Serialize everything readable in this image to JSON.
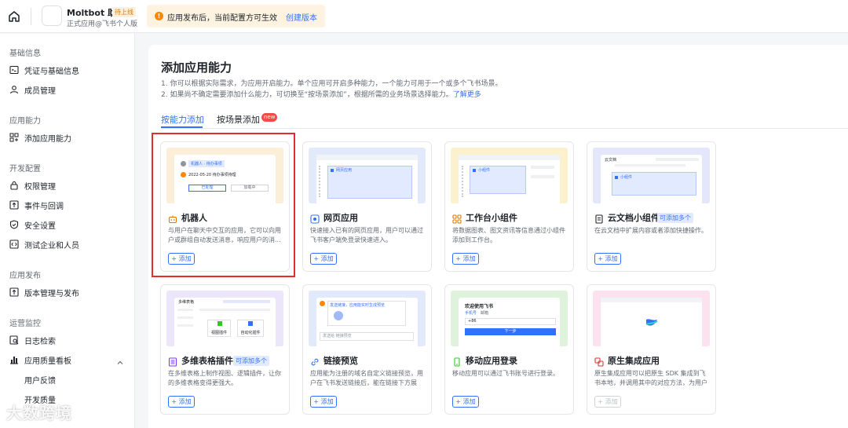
{
  "header": {
    "app_name": "Moltbot 助手",
    "app_badge": "待上线",
    "app_subtitle": "正式应用@飞书个人版",
    "notice_text": "应用发布后，当前配置方可生效",
    "notice_link": "创建版本"
  },
  "sidebar": {
    "sections": [
      {
        "label": "基础信息",
        "items": [
          {
            "label": "凭证与基础信息",
            "icon": "credential-icon"
          },
          {
            "label": "成员管理",
            "icon": "member-icon"
          }
        ]
      },
      {
        "label": "应用能力",
        "items": [
          {
            "label": "添加应用能力",
            "icon": "add-capability-icon"
          }
        ]
      },
      {
        "label": "开发配置",
        "items": [
          {
            "label": "权限管理",
            "icon": "permission-icon"
          },
          {
            "label": "事件与回调",
            "icon": "event-icon"
          },
          {
            "label": "安全设置",
            "icon": "security-icon"
          },
          {
            "label": "测试企业和人员",
            "icon": "test-icon"
          }
        ]
      },
      {
        "label": "应用发布",
        "items": [
          {
            "label": "版本管理与发布",
            "icon": "release-icon"
          }
        ]
      },
      {
        "label": "运营监控",
        "items": [
          {
            "label": "日志检索",
            "icon": "log-icon"
          },
          {
            "label": "应用质量看板",
            "icon": "dashboard-icon"
          }
        ]
      }
    ],
    "sub_items": [
      "用户反馈",
      "开发质量"
    ]
  },
  "main": {
    "title": "添加应用能力",
    "desc1": "1. 你可以根据实际需求，为应用开启能力。单个应用可开启多种能力，一个能力可用于一个或多个飞书场景。",
    "desc2": "2. 如果尚不确定需要添加什么能力，可切换至“按场景添加”，根据所需的业务场景选择能力。",
    "desc2_link": "了解更多",
    "tabs": [
      {
        "label": "按能力添加"
      },
      {
        "label": "按场景添加"
      }
    ],
    "new_badge": "new"
  },
  "cards": [
    {
      "name": "机器人",
      "badge": "",
      "desc": "与用户在聊天中交互的应用，它可以向用户或群组自动发送消息，响应用户的消...",
      "btn": "+ 添加",
      "color": "#fcefd9",
      "icon": "robot-icon",
      "preview": {
        "chip": "机器人 · 待办事项",
        "line": "2022-05-20 待办事项待理",
        "b1": "已处理",
        "b2": "加载中"
      }
    },
    {
      "name": "网页应用",
      "badge": "",
      "desc": "快速接入已有的网页应用，用户可以通过飞书客户端免登录快速进入。",
      "btn": "+ 添加",
      "color": "#e1e9fb",
      "icon": "web-app-icon",
      "preview": {
        "box": "网页应用"
      }
    },
    {
      "name": "工作台小组件",
      "badge": "",
      "desc": "将数据图表、图文资讯等信息通过小组件添加到工作台。",
      "btn": "+ 添加",
      "color": "#fbf1cd",
      "icon": "widget-icon",
      "preview": {
        "box": "小组件"
      }
    },
    {
      "name": "云文档小组件",
      "badge": "可添加多个",
      "desc": "在云文档中扩展内容或者添加快捷操作。",
      "btn": "+ 添加",
      "color": "#e4e6fb",
      "icon": "doc-widget-icon",
      "preview": {
        "title": "云文档",
        "box": "小组件"
      }
    },
    {
      "name": "多维表格插件",
      "badge": "可添加多个",
      "desc": "在多维表格上制作视图、逻辑插件，让你的多维表格变得更强大。",
      "btn": "+ 添加",
      "color": "#ece6fb",
      "icon": "base-plugin-icon",
      "preview": {
        "title": "多维表格",
        "b1": "视图插件",
        "b2": "自动化插件"
      }
    },
    {
      "name": "链接预览",
      "badge": "",
      "desc": "应用能为注册的域名自定义链接预览，用户在飞书发送链接后，能在链接下方展示...",
      "btn": "+ 添加",
      "color": "#e1e9fb",
      "icon": "link-preview-icon",
      "preview": {
        "msg": "发送链接，应用能实时生成预览",
        "input": "发送给 链接预览"
      }
    },
    {
      "name": "移动应用登录",
      "badge": "",
      "desc": "移动应用可以通过飞书账号进行登录。",
      "btn": "+ 添加",
      "color": "#dff3dc",
      "icon": "mobile-login-icon",
      "preview": {
        "title": "欢迎使用飞书",
        "tab1": "手机号",
        "tab2": "邮箱",
        "code": "+86",
        "btn": "下一步"
      }
    },
    {
      "name": "原生集成应用",
      "badge": "",
      "desc": "原生集成应用可以把原生 SDK 集成到飞书本地，并调用其中的对应方法，为用户提...",
      "btn": "+ 添加",
      "color": "#fbe2ee",
      "icon": "native-app-icon",
      "preview": {}
    }
  ],
  "watermark": "大数跨境"
}
